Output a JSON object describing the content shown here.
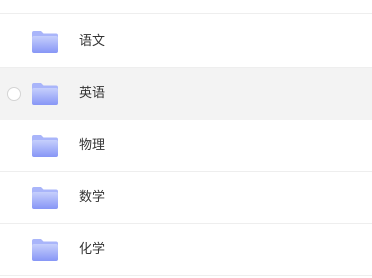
{
  "folders": [
    {
      "label": "语文",
      "icon": "folder-icon",
      "selected": false
    },
    {
      "label": "英语",
      "icon": "folder-icon",
      "selected": false,
      "hovered": true
    },
    {
      "label": "物理",
      "icon": "folder-icon",
      "selected": false
    },
    {
      "label": "数学",
      "icon": "folder-icon",
      "selected": false
    },
    {
      "label": "化学",
      "icon": "folder-icon",
      "selected": false
    }
  ],
  "colors": {
    "folder_light": "#b9c4fb",
    "folder_dark": "#7f8ff5",
    "hover_bg": "#f3f3f3",
    "divider": "#eeeeee",
    "text": "#333333"
  }
}
